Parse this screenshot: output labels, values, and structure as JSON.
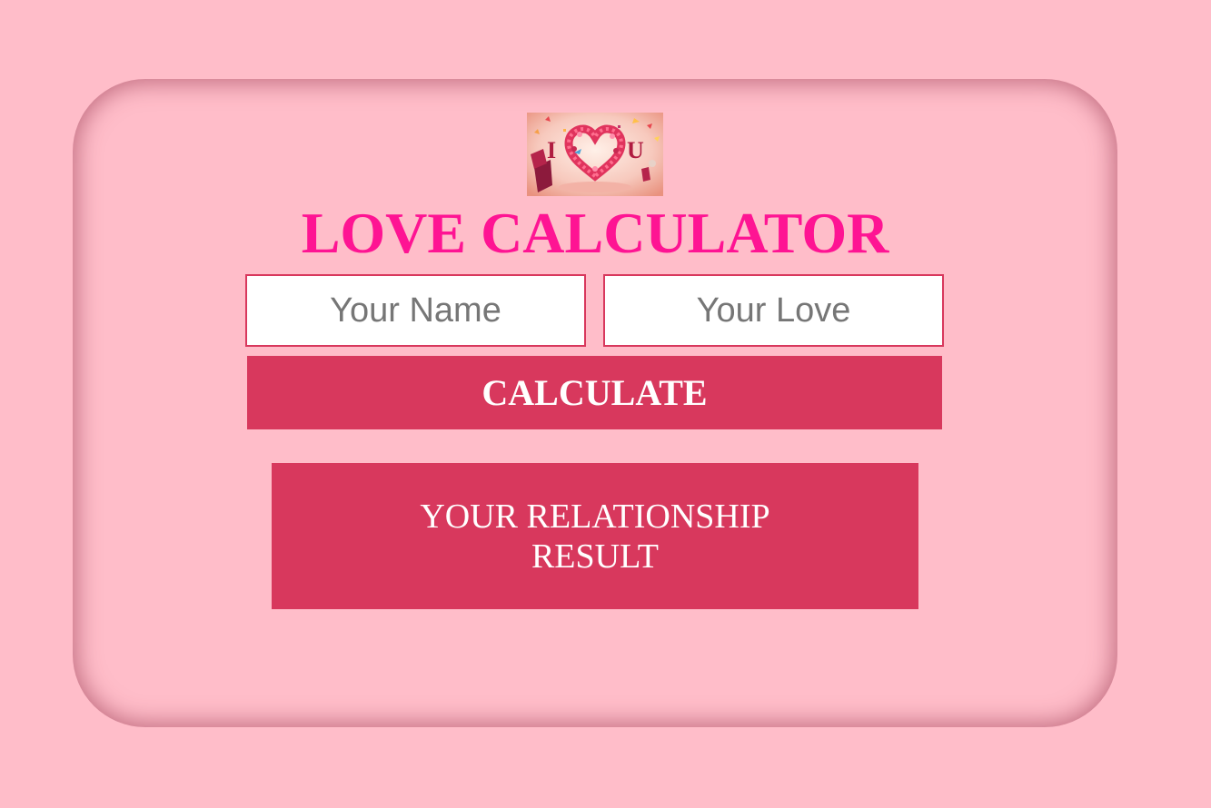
{
  "header": {
    "title": "LOVE CALCULATOR",
    "logo": {
      "icon": "i-love-u-heart-icon",
      "letters_left": "I",
      "letters_right": "U"
    }
  },
  "form": {
    "name_placeholder": "Your Name",
    "name_value": "",
    "love_placeholder": "Your Love",
    "love_value": "",
    "calculate_label": "CALCULATE"
  },
  "result": {
    "text": "YOUR RELATIONSHIP RESULT"
  },
  "colors": {
    "background": "#ffbdc9",
    "title": "#fe1493",
    "accent": "#d8385d",
    "button_text": "#ffffff"
  }
}
